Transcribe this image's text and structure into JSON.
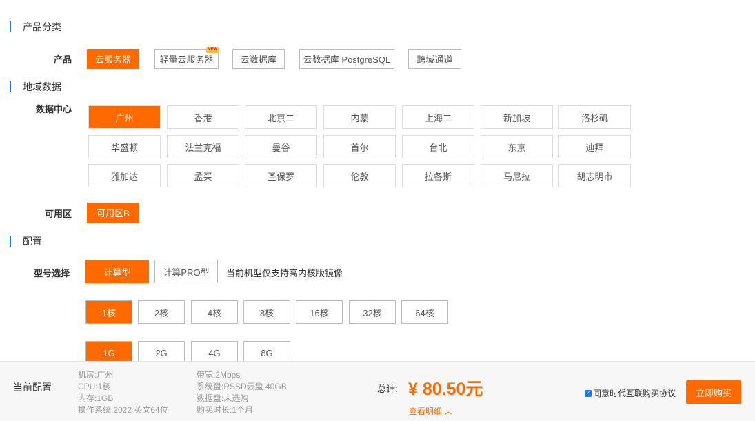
{
  "sections": {
    "category": "产品分类",
    "region": "地域数据",
    "config": "配置"
  },
  "labels": {
    "product": "产品",
    "datacenter": "数据中心",
    "zone": "可用区",
    "model": "型号选择"
  },
  "products": [
    "云服务器",
    "轻量云服务器",
    "云数据库",
    "云数据库 PostgreSQL",
    "跨域通道"
  ],
  "new_badge": "NEW",
  "datacenters": [
    [
      "广州",
      "香港",
      "北京二",
      "内蒙",
      "上海二",
      "新加坡",
      "洛杉矶"
    ],
    [
      "华盛顿",
      "法兰克福",
      "曼谷",
      "首尔",
      "台北",
      "东京",
      "迪拜"
    ],
    [
      "雅加达",
      "孟买",
      "圣保罗",
      "伦敦",
      "拉各斯",
      "马尼拉",
      "胡志明市"
    ]
  ],
  "zones": [
    "可用区B"
  ],
  "models": [
    "计算型",
    "计算PRO型"
  ],
  "model_note": "当前机型仅支持高内核版镜像",
  "cores": [
    "1核",
    "2核",
    "4核",
    "8核",
    "16核",
    "32核",
    "64核"
  ],
  "memory": [
    "1G",
    "2G",
    "4G",
    "8G"
  ],
  "footer": {
    "current_label": "当前配置",
    "spec_col1": [
      "机房:广州",
      "CPU:1核",
      "内存:1GB",
      "操作系统:2022 英文64位"
    ],
    "spec_col2": [
      "带宽:2Mbps",
      "系统盘:RSSD云盘 40GB",
      "数据盘:未选购",
      "购买时长:1个月"
    ],
    "total_label": "总计:",
    "price": "¥ 80.50元",
    "detail": "查看明细 ︿",
    "agree": "同意时代互联购买协议",
    "buy": "立即购买"
  },
  "colors": {
    "accent": "#ff6a00",
    "section_bar": "#1677ff"
  }
}
